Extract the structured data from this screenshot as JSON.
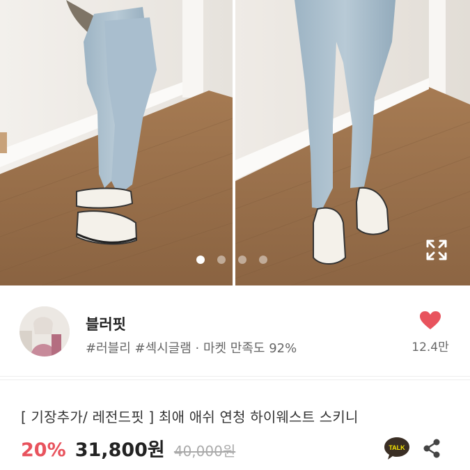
{
  "gallery": {
    "slide_count": 4,
    "active_slide": 1,
    "expand_icon": "expand-icon"
  },
  "seller": {
    "name": "블러핏",
    "tags": "#러블리 #섹시글램 · 마켓 만족도 92%",
    "like_count": "12.4만",
    "heart_icon": "heart-icon",
    "heart_color": "#e8535d"
  },
  "product": {
    "title": "[ 기장추가/ 레전드핏 ] 최애 애쉬 연청 하이웨스트 스키니",
    "discount": "20%",
    "price": "31,800원",
    "original_price": "40,000원",
    "discount_color": "#e8535d"
  },
  "actions": {
    "talk_label": "TALK",
    "share_icon": "share-icon"
  }
}
